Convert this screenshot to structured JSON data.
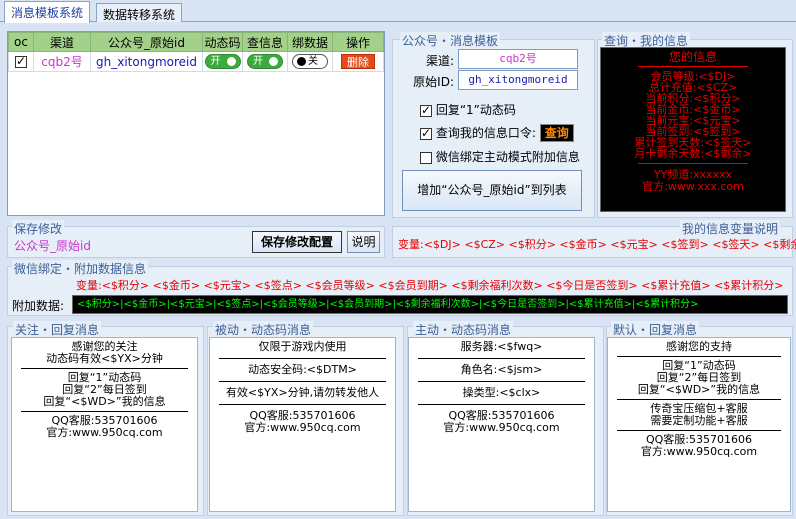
{
  "tabs": [
    "消息模板系统",
    "数据转移系统"
  ],
  "table": {
    "headers": [
      "oc",
      "渠道",
      "公众号_原始id",
      "动态码",
      "查信息",
      "绑数据",
      "操作"
    ],
    "row": {
      "channel": "cqb2号",
      "original_id": "gh_xitongmoreid",
      "dyn_code": "开",
      "query": "开",
      "bind": "关",
      "action": "删除"
    }
  },
  "template_panel": {
    "title": "公众号・消息模板",
    "channel_label": "渠道:",
    "channel_value": "cqb2号",
    "orig_label": "原始ID:",
    "orig_value": "gh_xitongmoreid",
    "opt1": "回复“1”动态码",
    "opt2": "查询我的信息口令:",
    "opt2_tag": "查询",
    "opt3": "微信绑定主动模式附加信息",
    "add_button": "增加“公众号_原始id”到列表"
  },
  "info_panel": {
    "title": "查询・我的信息",
    "lines": [
      "您的信息",
      "会员等级:<$DJ>",
      "总计充值:<$CZ>",
      "当前积分:<$积分>",
      "当前金币:<$金币>",
      "当前元宝:<$元宝>",
      "当前签到:<$签到>",
      "累计签到天数:<$签天>",
      "月卡剩余天数:<$剩余>",
      "YY频道:xxxxxx",
      "官方:www.xxx.com"
    ]
  },
  "save_panel": {
    "title": "保存修改",
    "value": "公众号_原始id",
    "save_button": "保存修改配置",
    "help_button": "说明"
  },
  "var_panel": {
    "title": "我的信息变量说明",
    "prefix": "变量:",
    "vars": "<$DJ>  <$CZ>  <$积分>  <$金币>  <$元宝>  <$签到>  <$签天>  <$剩余>"
  },
  "bind_panel": {
    "title": "微信绑定・附加数据信息",
    "prefix": "变量:",
    "vars": "<$积分>  <$金币>  <$元宝>  <$签点>  <$会员等级>  <$会员到期>  <$剩余福利次数>  <$今日是否签到>  <$累计充值>  <$累计积分>",
    "extra_label": "附加数据:",
    "extra_value": "<$积分>|<$金币>|<$元宝>|<$签点>|<$会员等级>|<$会员到期>|<$剩余福利次数>|<$今日是否签到>|<$累计充值>|<$累计积分>"
  },
  "msg_panels": [
    {
      "title": "关注・回复消息",
      "lines": [
        "感谢您的关注",
        "动态码有效<$YX>分钟",
        "",
        "回复“1”动态码",
        "回复“2”每日签到",
        "回复“<$WD>”我的信息",
        "",
        "QQ客服:535701606",
        "官方:www.950cq.com"
      ]
    },
    {
      "title": "被动・动态码消息",
      "lines": [
        "仅限于游戏内使用",
        "",
        "动态安全码:<$DTM>",
        "",
        "有效<$YX>分钟,请勿转发他人",
        "",
        "QQ客服:535701606",
        "官方:www.950cq.com"
      ]
    },
    {
      "title": "主动・动态码消息",
      "lines": [
        "服务器:<$fwq>",
        "",
        "角色名:<$jsm>",
        "",
        "操类型:<$clx>",
        "",
        "QQ客服:535701606",
        "官方:www.950cq.com"
      ]
    },
    {
      "title": "默认・回复消息",
      "lines": [
        "感谢您的支持",
        "",
        "回复“1”动态码",
        "回复“2”每日签到",
        "回复“<$WD>”我的信息",
        "",
        "传奇宝压缩包+客服",
        "需要定制功能+客服",
        "",
        "QQ客服:535701606",
        "官方:www.950cq.com"
      ]
    }
  ]
}
